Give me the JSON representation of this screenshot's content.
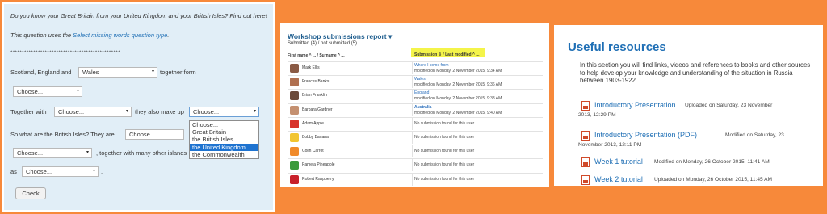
{
  "quiz": {
    "intro": "Do you know your Great Britain from your United Kingdom and your British Isles? Find out here!",
    "type_prefix": "This question uses the",
    "type_link": "Select missing words question type",
    "type_suffix": ".",
    "stars": "************************************************",
    "line1_pre": "Scotland, England and",
    "line1_sel": "Wales",
    "line1_post": "together form",
    "choose": "Choose...",
    "line2_pre": "Together with",
    "line2_mid": "they also make up",
    "line3_pre": "So what are the British Isles? They are",
    "line4_post": ", together with many other islands",
    "line5_pre": "as",
    "line5_post": ".",
    "dropdown_options": [
      "Choose...",
      "Great Britain",
      "the British Isles",
      "the United Kingdom",
      "the Commonwealth"
    ],
    "dropdown_highlight_index": 3,
    "check_button": "Check"
  },
  "workshop": {
    "title": "Workshop submissions report",
    "title_caret": "▾",
    "subtitle": "Submitted (4) / not submitted (5)",
    "col_name": "First name ^ ... / Surname ^ ...",
    "col_submission": "Submission ⇩ / Last modified ^ ...",
    "rows": [
      {
        "name": "Mark Ellis",
        "title": "Where I come from",
        "modified": "modified on Monday, 2 November 2015, 9:34 AM",
        "submitted": true,
        "avatar": "#8a5a44"
      },
      {
        "name": "Frances Banks",
        "title": "Wales",
        "modified": "modified on Monday, 2 November 2015, 9:36 AM",
        "submitted": true,
        "avatar": "#b07050"
      },
      {
        "name": "Brian Franklin",
        "title": "England",
        "modified": "modified on Monday, 2 November 2015, 9:38 AM",
        "submitted": true,
        "avatar": "#6b4a3a"
      },
      {
        "name": "Barbara Gardner",
        "title": "Australia",
        "modified": "modified on Monday, 2 November 2015, 9:40 AM",
        "submitted": true,
        "avatar": "#c49070"
      },
      {
        "name": "Adam Apple",
        "status": "No submission found for this user",
        "submitted": false,
        "avatar": "#d8332a"
      },
      {
        "name": "Bobby Banana",
        "status": "No submission found for this user",
        "submitted": false,
        "avatar": "#f2c530"
      },
      {
        "name": "Colin Carrot",
        "status": "No submission found for this user",
        "submitted": false,
        "avatar": "#f08a2a"
      },
      {
        "name": "Pamela Pineapple",
        "status": "No submission found for this user",
        "submitted": false,
        "avatar": "#3a9a3a"
      },
      {
        "name": "Robert Raspberry",
        "status": "No submission found for this user",
        "submitted": false,
        "avatar": "#c8202a"
      }
    ]
  },
  "resources": {
    "title": "Useful resources",
    "intro": "In this section you will find links, videos and references to books and other sources to help develop your knowledge and understanding of the situation in Russia between 1903-1922.",
    "items": [
      {
        "link": "Introductory Presentation",
        "meta": "Uploaded on Saturday, 23 November",
        "meta2": "2013, 12:29 PM"
      },
      {
        "link": "Introductory Presentation (PDF)",
        "meta": "Modified on Saturday, 23",
        "meta2": "November 2013, 12:11 PM"
      },
      {
        "link": "Week 1 tutorial",
        "meta": "Modified on Monday, 26 October 2015, 11:41 AM"
      },
      {
        "link": "Week 2 tutorial",
        "meta": "Uploaded on Monday, 26 October 2015, 11:45 AM"
      }
    ],
    "icon": "file-icon"
  }
}
